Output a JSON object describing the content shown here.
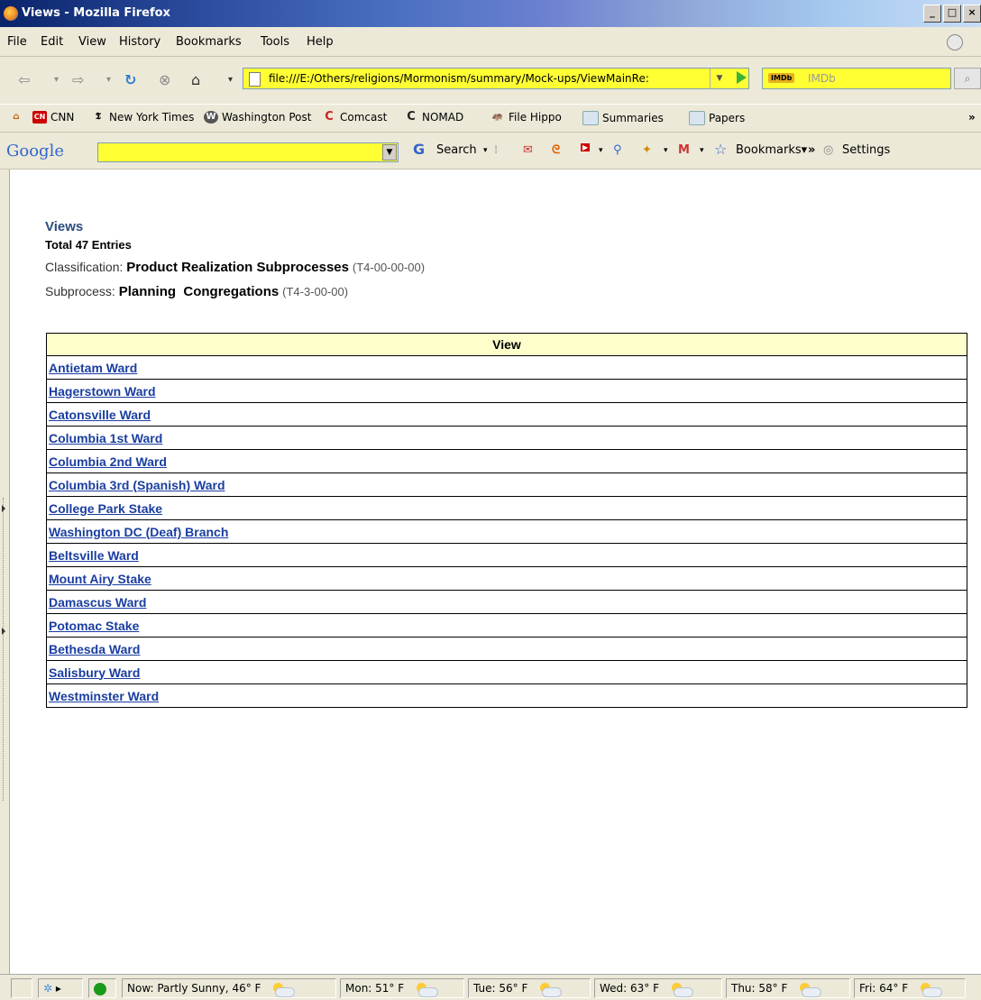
{
  "window": {
    "title": "Views - Mozilla Firefox"
  },
  "menubar": [
    "File",
    "Edit",
    "View",
    "History",
    "Bookmarks",
    "Tools",
    "Help"
  ],
  "navbar": {
    "url": "file:///E:/Others/religions/Mormonism/summary/Mock-ups/ViewMainRe:",
    "search_engine_label": "IMDb",
    "search_engine_badge": "IMDb"
  },
  "bookmarks": [
    "CNN",
    "New York Times",
    "Washington Post",
    "Comcast",
    "NOMAD",
    "File Hippo",
    "Summaries",
    "Papers"
  ],
  "google_toolbar": {
    "logo": "Google",
    "search_label": "Search",
    "bookmarks_label": "Bookmarks",
    "settings_label": "Settings"
  },
  "page": {
    "heading": "Views",
    "total": "Total 47 Entries",
    "classification_label": "Classification:",
    "classification_value": "Product Realization Subprocesses",
    "classification_code": "(T4-00-00-00)",
    "subprocess_label": "Subprocess:",
    "subprocess_value": "Planning  Congregations",
    "subprocess_code": "(T4-3-00-00)",
    "table_header": "View",
    "views": [
      "Antietam Ward",
      "Hagerstown Ward",
      "Catonsville Ward",
      "Columbia 1st Ward",
      "Columbia 2nd Ward",
      "Columbia 3rd (Spanish) Ward",
      "College Park Stake",
      "Washington DC (Deaf) Branch",
      "Beltsville Ward",
      "Mount Airy Stake",
      "Damascus Ward",
      "Potomac Stake",
      "Bethesda Ward",
      "Salisbury Ward",
      "Westminster Ward"
    ]
  },
  "statusbar": {
    "weather": [
      "Now: Partly Sunny, 46° F",
      "Mon: 51° F",
      "Tue: 56° F",
      "Wed: 63° F",
      "Thu: 58° F",
      "Fri: 64° F"
    ]
  },
  "colors": {
    "address_bar_bg": "#ffff33",
    "table_header_bg": "#ffffcc",
    "link": "#1a3ea0",
    "heading": "#2a4d7c"
  }
}
